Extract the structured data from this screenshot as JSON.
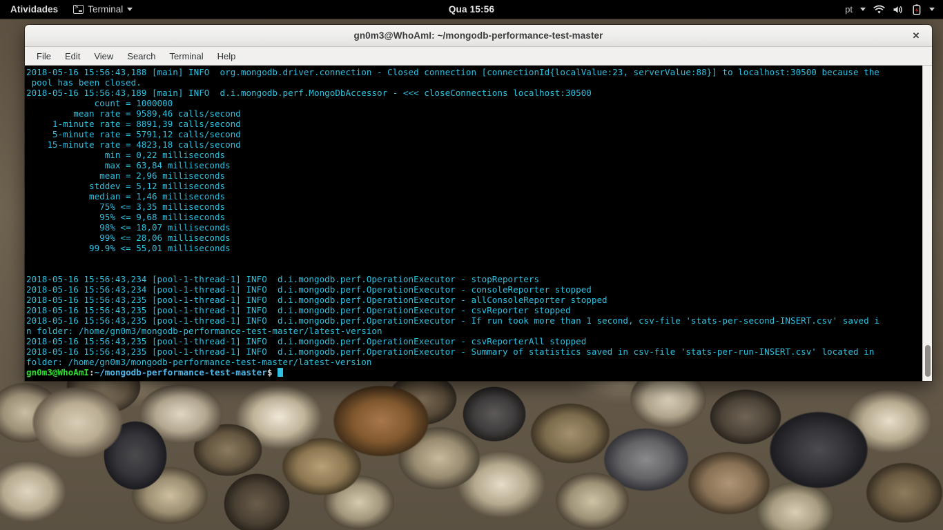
{
  "topbar": {
    "activities": "Atividades",
    "app_name": "Terminal",
    "app_icon": "terminal-icon",
    "app_caret_icon": "chevron-down-icon",
    "clock": "Qua 15:56",
    "keyboard_layout": "pt",
    "keyboard_caret_icon": "chevron-down-icon",
    "wifi_icon": "wifi-icon",
    "volume_icon": "volume-icon",
    "battery_icon": "battery-charging-icon",
    "system_menu_caret_icon": "chevron-down-icon",
    "bg_color": "#000000",
    "fg_color": "#d7d7d7"
  },
  "window": {
    "title": "gn0m3@WhoAmI: ~/mongodb-performance-test-master",
    "close_label": "✕",
    "menu": [
      "File",
      "Edit",
      "View",
      "Search",
      "Terminal",
      "Help"
    ]
  },
  "terminal": {
    "bg_color": "#000000",
    "fg_color": "#2fc0e0",
    "prompt_user_color": "#2ee02e",
    "prompt_path_color": "#4fb7e8",
    "lines": [
      "2018-05-16 15:56:43,188 [main] INFO  org.mongodb.driver.connection - Closed connection [connectionId{localValue:23, serverValue:88}] to localhost:30500 because the",
      " pool has been closed.",
      "2018-05-16 15:56:43,189 [main] INFO  d.i.mongodb.perf.MongoDbAccessor - <<< closeConnections localhost:30500",
      "             count = 1000000",
      "         mean rate = 9589,46 calls/second",
      "     1-minute rate = 8891,39 calls/second",
      "     5-minute rate = 5791,12 calls/second",
      "    15-minute rate = 4823,18 calls/second",
      "               min = 0,22 milliseconds",
      "               max = 63,84 milliseconds",
      "              mean = 2,96 milliseconds",
      "            stddev = 5,12 milliseconds",
      "            median = 1,46 milliseconds",
      "              75% <= 3,35 milliseconds",
      "              95% <= 9,68 milliseconds",
      "              98% <= 18,07 milliseconds",
      "              99% <= 28,06 milliseconds",
      "            99.9% <= 55,01 milliseconds",
      "",
      "",
      "2018-05-16 15:56:43,234 [pool-1-thread-1] INFO  d.i.mongodb.perf.OperationExecutor - stopReporters",
      "2018-05-16 15:56:43,234 [pool-1-thread-1] INFO  d.i.mongodb.perf.OperationExecutor - consoleReporter stopped",
      "2018-05-16 15:56:43,235 [pool-1-thread-1] INFO  d.i.mongodb.perf.OperationExecutor - allConsoleReporter stopped",
      "2018-05-16 15:56:43,235 [pool-1-thread-1] INFO  d.i.mongodb.perf.OperationExecutor - csvReporter stopped",
      "2018-05-16 15:56:43,235 [pool-1-thread-1] INFO  d.i.mongodb.perf.OperationExecutor - If run took more than 1 second, csv-file 'stats-per-second-INSERT.csv' saved i",
      "n folder: /home/gn0m3/mongodb-performance-test-master/latest-version",
      "2018-05-16 15:56:43,235 [pool-1-thread-1] INFO  d.i.mongodb.perf.OperationExecutor - csvReporterAll stopped",
      "2018-05-16 15:56:43,235 [pool-1-thread-1] INFO  d.i.mongodb.perf.OperationExecutor - Summary of statistics saved in csv-file 'stats-per-run-INSERT.csv' located in",
      "folder: /home/gn0m3/mongodb-performance-test-master/latest-version"
    ],
    "prompt": {
      "user_host": "gn0m3@WhoAmI",
      "separator": ":",
      "path": "~/mongodb-performance-test-master",
      "symbol": "$"
    }
  }
}
